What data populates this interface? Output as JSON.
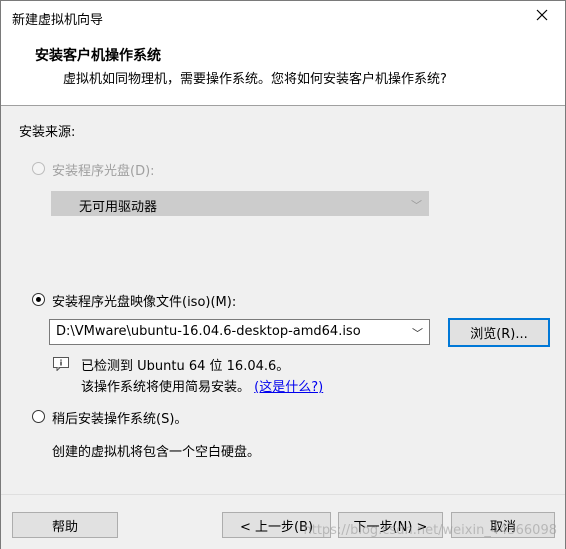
{
  "window": {
    "title": "新建虚拟机向导"
  },
  "header": {
    "title": "安装客户机操作系统",
    "subtitle": "虚拟机如同物理机，需要操作系统。您将如何安装客户机操作系统?"
  },
  "source": {
    "label": "安装来源:",
    "disc_option": {
      "label": "安装程序光盘(D):",
      "enabled": false,
      "checked": false
    },
    "disc_drive": {
      "value": "无可用驱动器"
    },
    "iso_option": {
      "label": "安装程序光盘映像文件(iso)(M):",
      "checked": true
    },
    "iso_path": {
      "value": "D:\\VMware\\ubuntu-16.04.6-desktop-amd64.iso"
    },
    "browse_label": "浏览(R)...",
    "detect_line1": "已检测到 Ubuntu 64 位 16.04.6。",
    "detect_line2": "该操作系统将使用简易安装。",
    "detect_link": "(这是什么?)",
    "later_option": {
      "label": "稍后安装操作系统(S)。",
      "checked": false
    },
    "later_desc": "创建的虚拟机将包含一个空白硬盘。"
  },
  "footer": {
    "help": "帮助",
    "back": "< 上一步(B)",
    "next": "下一步(N) >",
    "cancel": "取消",
    "watermark": "https://blog.csdn.net/weixin_44366098"
  },
  "icons": [
    "close-icon",
    "info-icon",
    "chevron-down-icon"
  ]
}
